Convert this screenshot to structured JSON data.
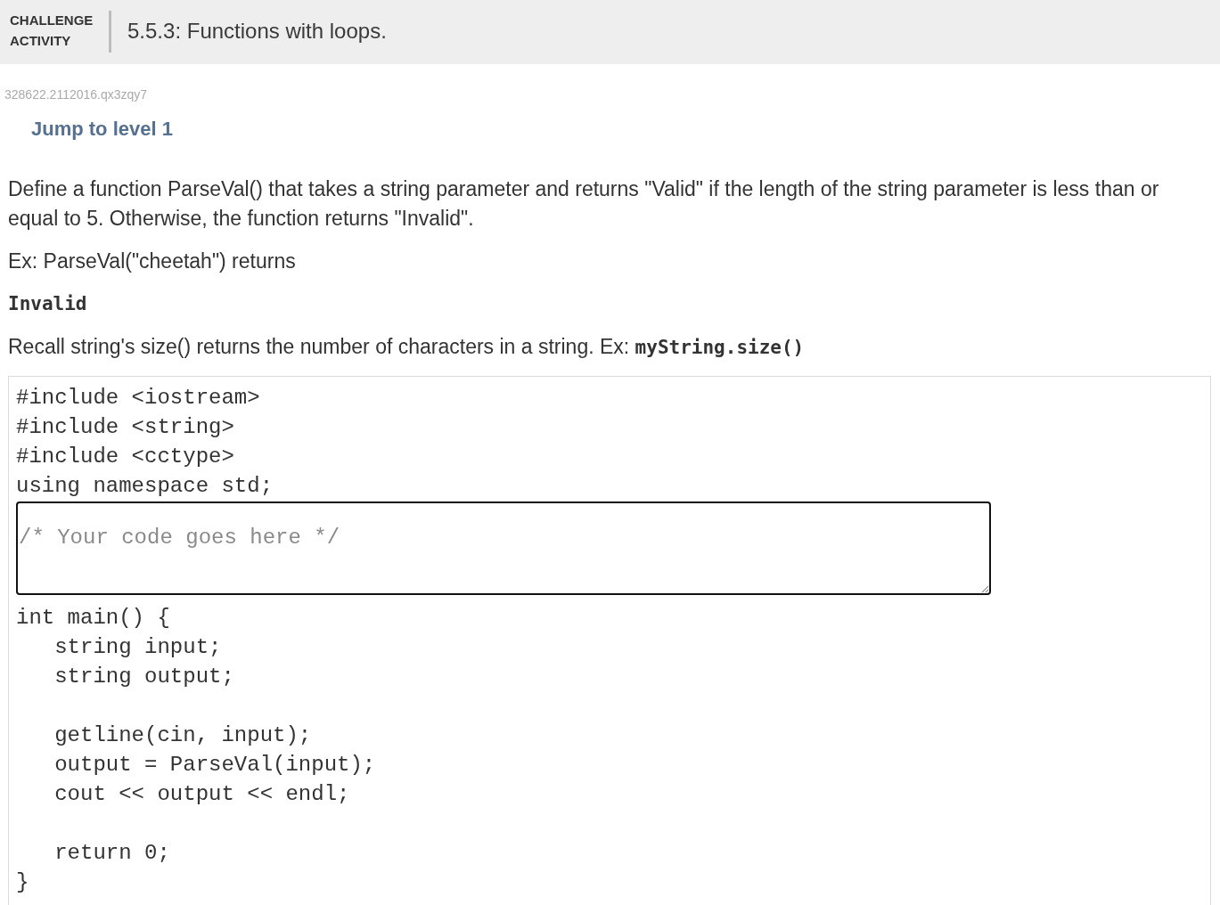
{
  "header": {
    "label": "CHALLENGE ACTIVITY",
    "title": "5.5.3: Functions with loops."
  },
  "activity_id": "328622.2112016.qx3zqy7",
  "jump_link": "Jump to level 1",
  "instructions": [
    {
      "kind": "text",
      "text": "Define a function ParseVal() that takes a string parameter and returns \"Valid\" if the length of the string parameter is less than or equal to 5. Otherwise, the function returns \"Invalid\"."
    },
    {
      "kind": "text",
      "text": "Ex: ParseVal(\"cheetah\") returns"
    },
    {
      "kind": "output",
      "text": "Invalid"
    },
    {
      "kind": "text_with_code",
      "text": "Recall string's size() returns the number of characters in a string. Ex:",
      "code": "myString.size()"
    }
  ],
  "code_editor": {
    "code_before": "#include <iostream>\n#include <string>\n#include <cctype>\nusing namespace std;",
    "input": {
      "placeholder": "/* Your code goes here */"
    },
    "code_after": "int main() {\n   string input;\n   string output;\n\n   getline(cin, input);\n   output = ParseVal(input);\n   cout << output << endl;\n\n   return 0;\n}"
  }
}
